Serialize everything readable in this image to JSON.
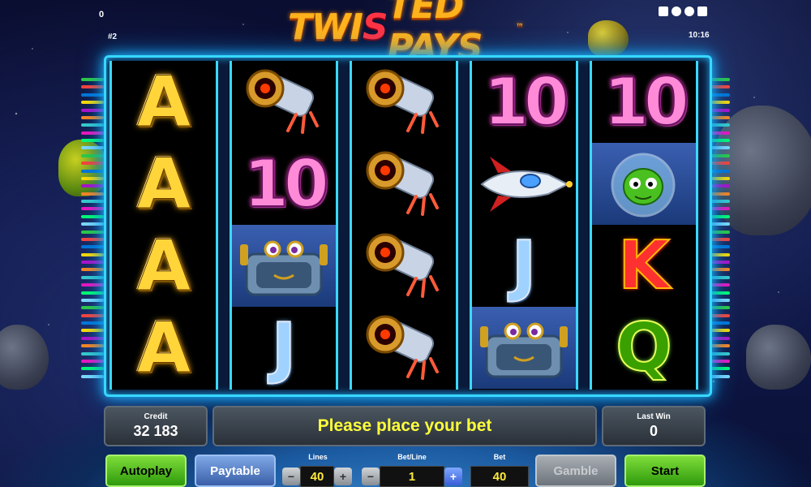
{
  "header": {
    "top_left_value": "0",
    "game_number": "#2",
    "clock": "10:16",
    "logo": {
      "prefix": "TWI",
      "twist": "S",
      "suffix": "TED PAYS",
      "tm": "™"
    }
  },
  "reels": [
    [
      "A",
      "A",
      "A",
      "A"
    ],
    [
      "rocket-eye",
      "10",
      "robot-crab",
      "J"
    ],
    [
      "rocket-eye",
      "rocket-eye",
      "rocket-eye",
      "rocket-eye"
    ],
    [
      "10",
      "spaceship",
      "J",
      "robot-crab"
    ],
    [
      "10",
      "alien",
      "K",
      "Q"
    ]
  ],
  "bottom": {
    "credit_label": "Credit",
    "credit_value": "32 183",
    "message": "Please place your bet",
    "last_win_label": "Last Win",
    "last_win_value": "0",
    "autoplay_label": "Autoplay",
    "paytable_label": "Paytable",
    "lines_label": "Lines",
    "lines_value": "40",
    "bet_line_label": "Bet/Line",
    "bet_line_value": "1",
    "bet_label": "Bet",
    "bet_value": "40",
    "gamble_label": "Gamble",
    "start_label": "Start",
    "minus": "−",
    "plus": "+"
  },
  "colors": {
    "frame": "#37d8ff",
    "message": "#ffff3a",
    "start_button": "#2e9a0c"
  }
}
